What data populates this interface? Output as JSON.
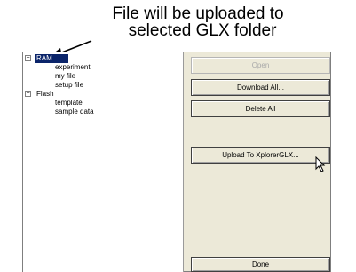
{
  "annotation": {
    "line1": "File will be uploaded to",
    "line2": "selected GLX folder"
  },
  "tree": {
    "ram": {
      "label": "RAM",
      "expander": "−"
    },
    "ram_items": [
      "experiment",
      "my file",
      "setup file"
    ],
    "flash": {
      "label": "Flash",
      "expander": "−"
    },
    "flash_items": [
      "template",
      "sample data"
    ]
  },
  "buttons": {
    "open": "Open",
    "download_all": "Download All...",
    "delete_all": "Delete All",
    "upload": "Upload To XplorerGLX...",
    "done": "Done"
  }
}
